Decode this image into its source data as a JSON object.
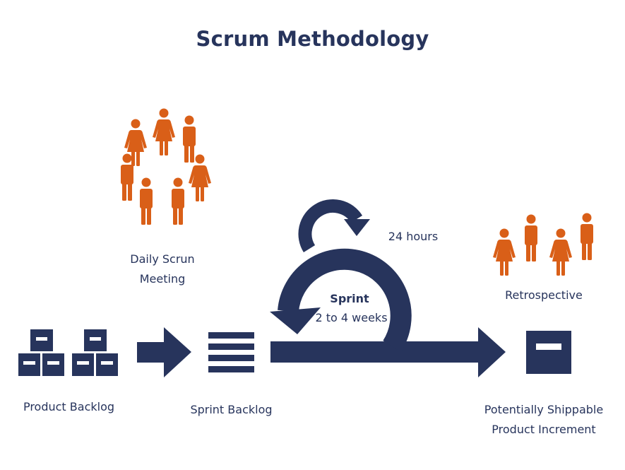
{
  "title": "Scrum Methodology",
  "colors": {
    "primary_navy": "#27345c",
    "accent_orange": "#d95f18",
    "background": "#ffffff"
  },
  "stages": {
    "product_backlog": {
      "label": "Product Backlog",
      "icon": "stacked-boxes-icon",
      "box_count": 6
    },
    "sprint_backlog": {
      "label": "Sprint Backlog",
      "icon": "list-lines-icon",
      "line_count": 4
    },
    "daily_scrum": {
      "label_line1": "Daily Scrun",
      "label_line2": "Meeting",
      "icon": "people-circle-icon",
      "people_count": 7
    },
    "sprint": {
      "label": "Sprint",
      "duration": "2 to 4 weeks",
      "icon": "sprint-loop-arrow-icon"
    },
    "daily_cycle": {
      "label": "24 hours",
      "icon": "daily-loop-arrow-icon"
    },
    "retrospective": {
      "label": "Retrospective",
      "icon": "people-row-icon",
      "people_count": 4
    },
    "increment": {
      "label_line1": "Potentially Shippable",
      "label_line2": "Product Increment",
      "icon": "box-icon"
    }
  }
}
